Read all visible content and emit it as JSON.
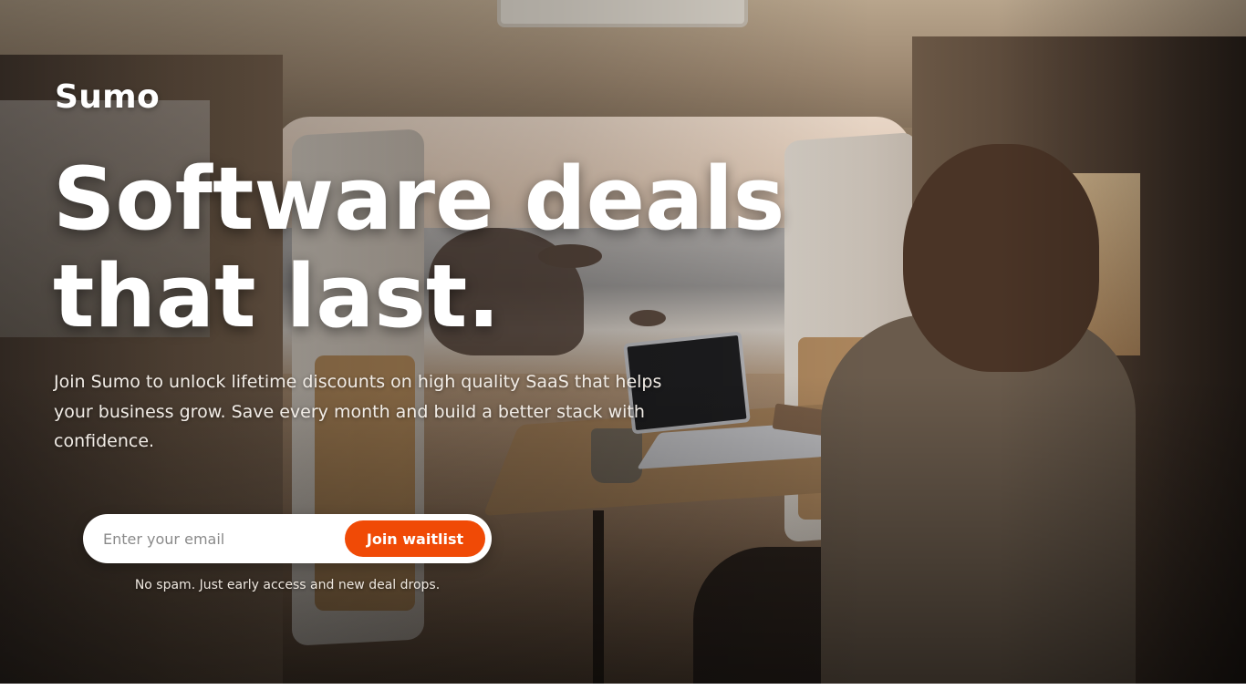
{
  "brand": {
    "name": "Sumo"
  },
  "hero": {
    "headline_line1": "Software deals",
    "headline_line2": "that last.",
    "subtext": "Join Sumo to unlock lifetime discounts on high quality SaaS that helps your business grow. Save every month and build a better stack with confidence.",
    "background_image": "van-interior-ocean-view"
  },
  "signup": {
    "email_placeholder": "Enter your email",
    "email_value": "",
    "button_label": "Join waitlist",
    "note": "No spam. Just early access and new deal drops."
  },
  "colors": {
    "accent": "#f04a06",
    "text_primary": "#ffffff"
  }
}
